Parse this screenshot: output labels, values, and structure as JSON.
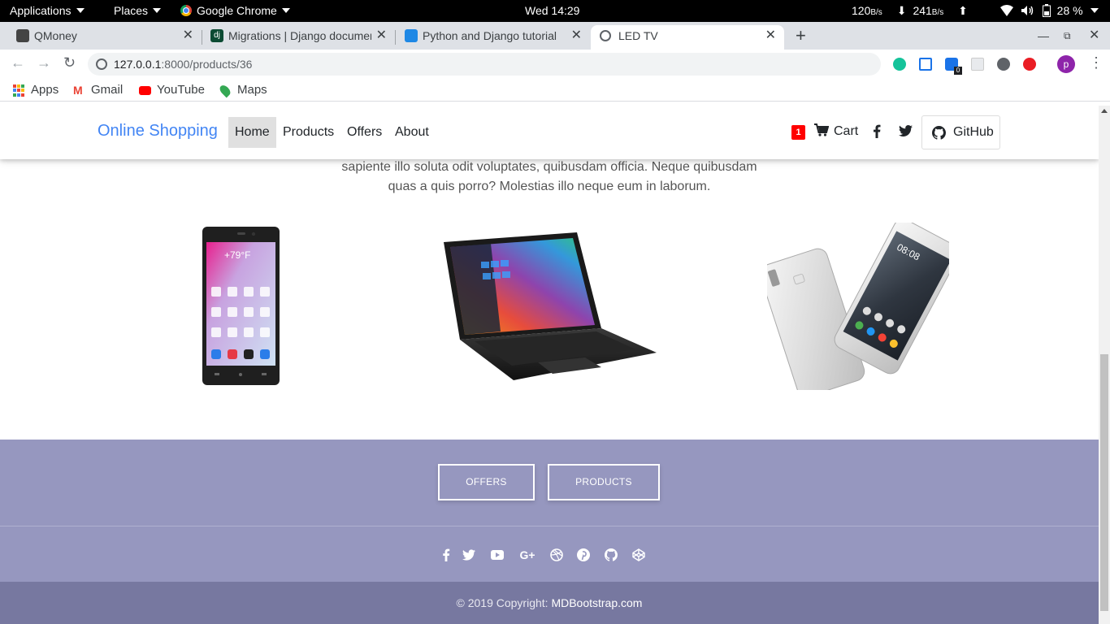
{
  "gnome": {
    "applications": "Applications",
    "places": "Places",
    "chrome": "Google Chrome",
    "clock": "Wed 14:29",
    "net_down": "120",
    "net_down_unit": "B/s",
    "net_up": "241",
    "net_up_unit": "B/s",
    "battery": "28 %"
  },
  "tabs": [
    {
      "title": "QMoney",
      "active": false
    },
    {
      "title": "Migrations | Django documentation",
      "active": false
    },
    {
      "title": "Python and Django tutorial",
      "active": false
    },
    {
      "title": "LED TV",
      "active": true
    }
  ],
  "new_tab": "+",
  "address": {
    "host": "127.0.0.1",
    "path": ":8000/products/36"
  },
  "extensions": {
    "badge_count": "0",
    "avatar_letter": "p"
  },
  "bookmarks": [
    "Apps",
    "Gmail",
    "YouTube",
    "Maps"
  ],
  "site": {
    "brand": "Online Shopping",
    "nav": [
      "Home",
      "Products",
      "Offers",
      "About"
    ],
    "cart_count": "1",
    "cart_label": "Cart",
    "github_label": "GitHub",
    "description_line1": "sapiente illo soluta odit voluptates, quibusdam officia. Neque quibusdam",
    "description_line2": "quas a quis porro? Molestias illo neque eum in laborum.",
    "footer_buttons": [
      "OFFERS",
      "PRODUCTS"
    ],
    "copyright_prefix": "© 2019 Copyright:",
    "copyright_link": "MDBootstrap.com"
  },
  "icons": [
    "facebook-icon",
    "twitter-icon",
    "youtube-icon",
    "google-plus-icon",
    "dribbble-icon",
    "pinterest-icon",
    "github-icon",
    "codepen-icon"
  ],
  "colors": {
    "brand": "#4285f4",
    "footer": "#9697bf",
    "footer_bottom": "#7778a0",
    "badge": "#ff0000"
  }
}
